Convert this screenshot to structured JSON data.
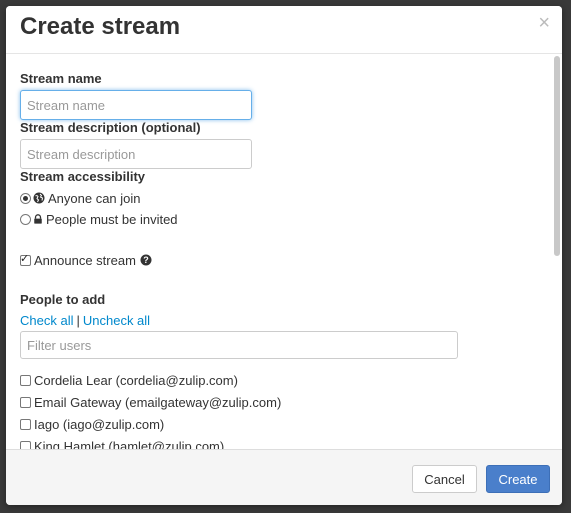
{
  "modal": {
    "title": "Create stream",
    "close_label": "×"
  },
  "form": {
    "stream_name_label": "Stream name",
    "stream_name_placeholder": "Stream name",
    "stream_name_value": "",
    "description_label": "Stream description (optional)",
    "description_placeholder": "Stream description",
    "description_value": "",
    "accessibility_label": "Stream accessibility",
    "access_options": [
      {
        "label": "Anyone can join",
        "icon": "globe-icon",
        "checked": true
      },
      {
        "label": "People must be invited",
        "icon": "lock-icon",
        "checked": false
      }
    ],
    "announce_label": "Announce stream",
    "announce_checked": true,
    "announce_help_icon": "question-circle-icon"
  },
  "people": {
    "label": "People to add",
    "check_all": "Check all",
    "separator": "|",
    "uncheck_all": "Uncheck all",
    "filter_placeholder": "Filter users",
    "users": [
      {
        "label": "Cordelia Lear (cordelia@zulip.com)",
        "checked": false
      },
      {
        "label": "Email Gateway (emailgateway@zulip.com)",
        "checked": false
      },
      {
        "label": "Iago (iago@zulip.com)",
        "checked": false
      },
      {
        "label": "King Hamlet (hamlet@zulip.com)",
        "checked": false
      }
    ]
  },
  "footer": {
    "cancel_label": "Cancel",
    "create_label": "Create"
  },
  "colors": {
    "accent": "#4a7fcb",
    "link": "#0088cc",
    "focus": "#66afe9"
  }
}
